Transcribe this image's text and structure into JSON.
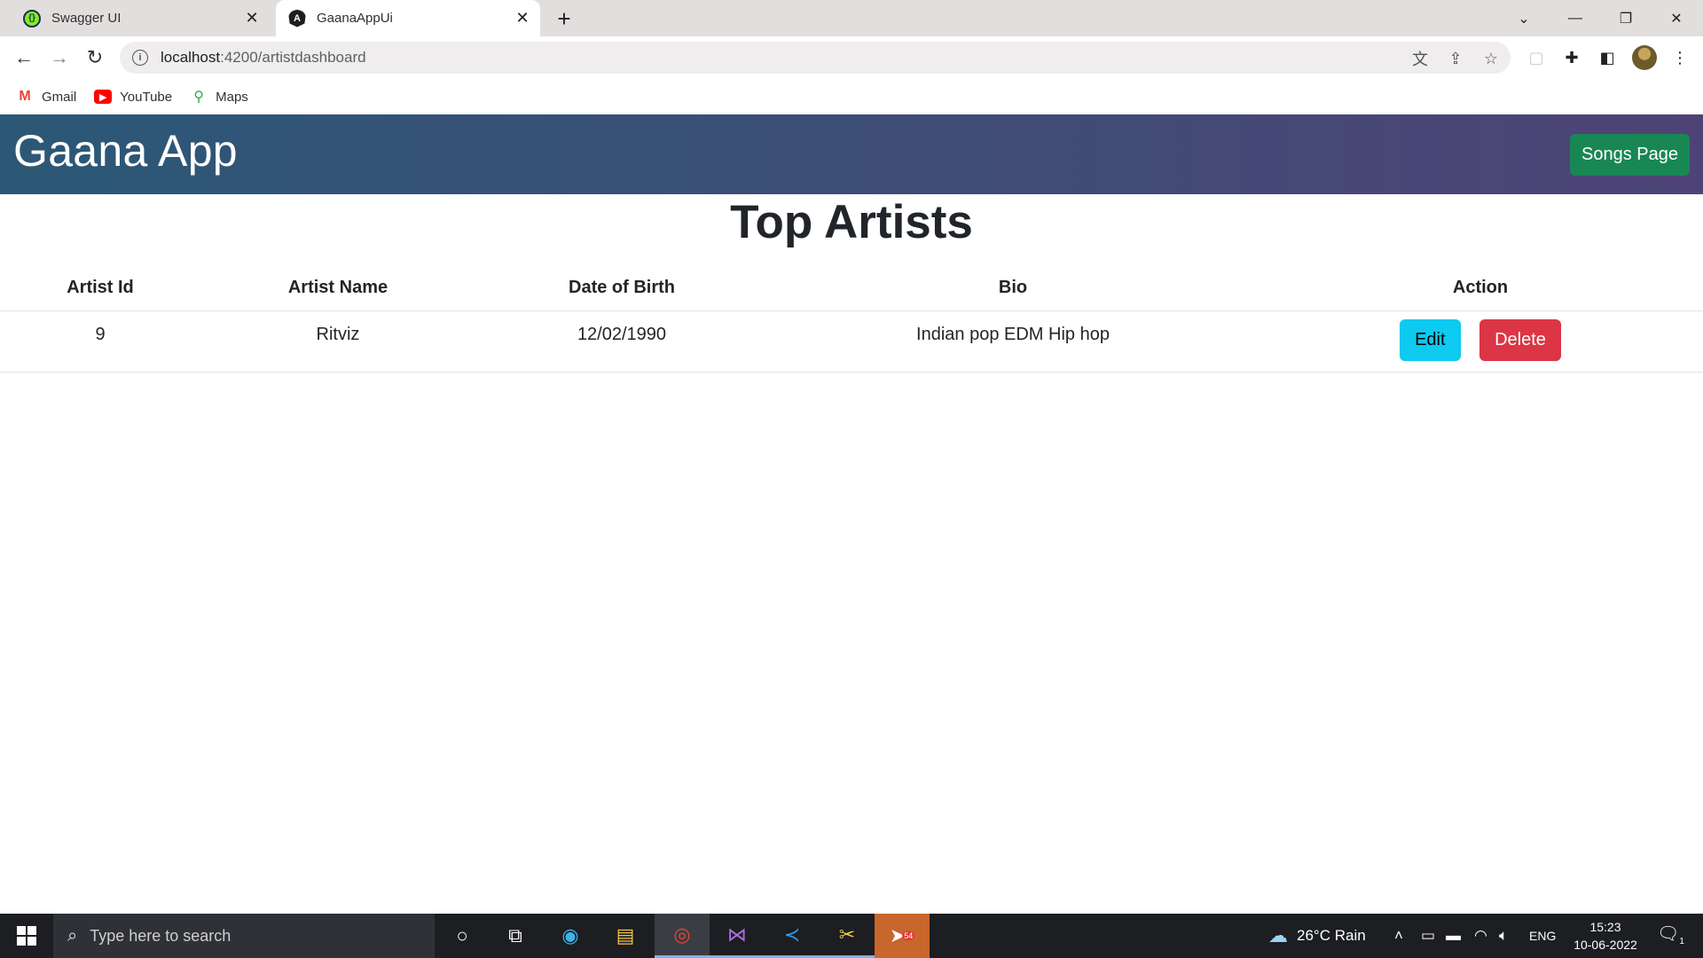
{
  "browser": {
    "tabs": [
      {
        "title": "Swagger UI",
        "icon": "swagger-icon",
        "active": false
      },
      {
        "title": "GaanaAppUi",
        "icon": "angular-icon",
        "active": true
      }
    ],
    "url_host": "localhost",
    "url_path": ":4200/artistdashboard",
    "bookmarks": [
      {
        "label": "Gmail",
        "icon": "gmail-icon"
      },
      {
        "label": "YouTube",
        "icon": "youtube-icon"
      },
      {
        "label": "Maps",
        "icon": "maps-icon"
      }
    ]
  },
  "app": {
    "brand": "Gaana App",
    "songs_button": "Songs Page",
    "accent_colors": {
      "header_start": "#2b5876",
      "header_end": "#4e4376",
      "success": "#198754",
      "info": "#0dcaf0",
      "danger": "#dc3545"
    }
  },
  "main": {
    "title": "Top Artists",
    "table": {
      "headers": [
        "Artist Id",
        "Artist Name",
        "Date of Birth",
        "Bio",
        "Action"
      ],
      "rows": [
        {
          "id": "9",
          "name": "Ritviz",
          "dob": "12/02/1990",
          "bio": "Indian pop EDM Hip hop"
        }
      ],
      "edit_label": "Edit",
      "delete_label": "Delete"
    }
  },
  "taskbar": {
    "search_placeholder": "Type here to search",
    "weather": "26°C  Rain",
    "language": "ENG",
    "time": "15:23",
    "date": "10-06-2022",
    "telegram_badge": "54",
    "notification_count": "1"
  }
}
